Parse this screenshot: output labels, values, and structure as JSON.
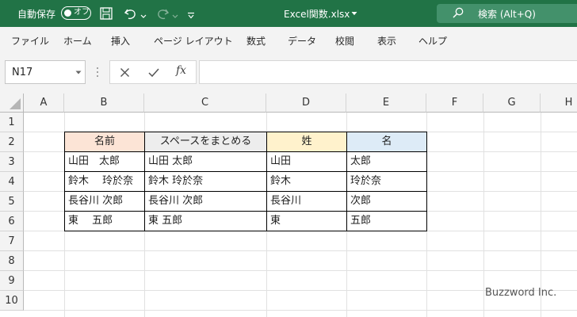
{
  "titlebar": {
    "autosave_label": "自動保存",
    "autosave_state": "オフ",
    "filename": "Excel関数.xlsx",
    "search_label": "検索 (Alt+Q)",
    "bg_color": "#217346"
  },
  "ribbon": {
    "tabs": [
      "ファイル",
      "ホーム",
      "挿入",
      "ページ レイアウト",
      "数式",
      "データ",
      "校閲",
      "表示",
      "ヘルプ"
    ]
  },
  "formula_bar": {
    "name_box": "N17",
    "fx": "fx",
    "formula": ""
  },
  "sheet": {
    "columns": [
      "A",
      "B",
      "C",
      "D",
      "E",
      "F",
      "G",
      "H"
    ],
    "rows": [
      "1",
      "2",
      "3",
      "4",
      "5",
      "6",
      "7",
      "8",
      "9",
      "10"
    ],
    "table": {
      "headers": [
        "名前",
        "スペースをまとめる",
        "姓",
        "名"
      ],
      "header_colors": [
        "#fce4d6",
        "#ededed",
        "#fff2cc",
        "#ddebf7"
      ],
      "rows": [
        [
          "山田　太郎",
          "山田 太郎",
          "山田",
          "太郎"
        ],
        [
          "鈴木　 玲於奈",
          "鈴木 玲於奈",
          "鈴木",
          "玲於奈"
        ],
        [
          "長谷川 次郎",
          "長谷川 次郎",
          "長谷川",
          "次郎"
        ],
        [
          "東　 五郎",
          "東 五郎",
          "東",
          "五郎"
        ]
      ]
    }
  },
  "watermark": "Buzzword Inc."
}
